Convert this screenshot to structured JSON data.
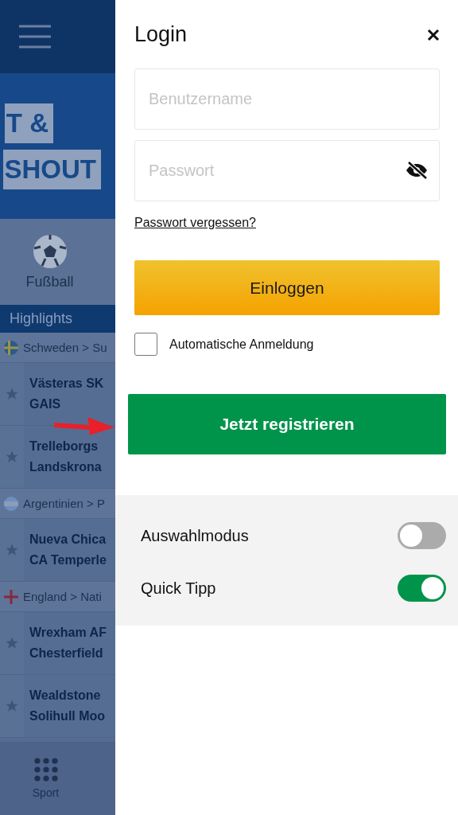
{
  "background": {
    "banner": [
      "T &",
      "SHOUT"
    ],
    "sports": [
      {
        "label": "Fußball"
      }
    ],
    "section_title": "Highlights",
    "groups": [
      {
        "league": "Schweden > Su",
        "flag": {
          "kind": "sweden"
        },
        "matches": [
          {
            "home": "Västeras SK",
            "away": "GAIS"
          },
          {
            "home": "Trelleborgs",
            "away": "Landskrona"
          }
        ]
      },
      {
        "league": "Argentinien > P",
        "flag": {
          "kind": "argentina"
        },
        "matches": [
          {
            "home": "Nueva Chica",
            "away": "CA Temperle"
          }
        ]
      },
      {
        "league": "England > Nati",
        "flag": {
          "kind": "england"
        },
        "matches": [
          {
            "home": "Wrexham AF",
            "away": "Chesterfield"
          },
          {
            "home": "Wealdstone",
            "away": "Solihull Moo"
          }
        ]
      }
    ],
    "bottom_nav": {
      "label": "Sport"
    }
  },
  "login": {
    "title": "Login",
    "fields": [
      {
        "kind": "text",
        "placeholder": "Benutzername"
      },
      {
        "kind": "password",
        "placeholder": "Passwort"
      }
    ],
    "forgot_link": "Passwort vergessen?",
    "login_button": "Einloggen",
    "auto_login": {
      "label": "Automatische Anmeldung",
      "checked": false
    },
    "register_button": "Jetzt registrieren",
    "settings": [
      {
        "label": "Auswahlmodus",
        "on": false
      },
      {
        "label": "Quick Tipp",
        "on": true
      }
    ]
  }
}
